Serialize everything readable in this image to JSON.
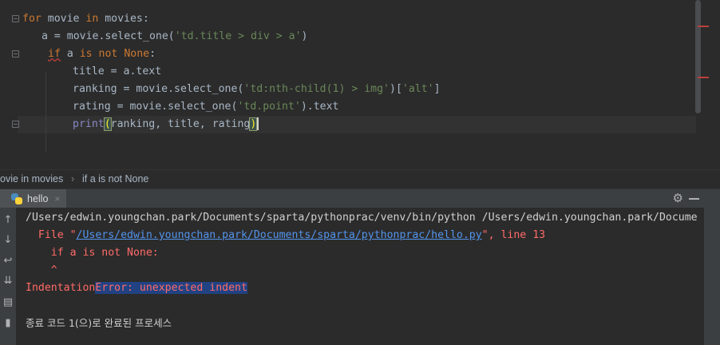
{
  "editor": {
    "code": {
      "l1": {
        "kw1": "for",
        "t1": " movie ",
        "kw2": "in",
        "t2": " movies:"
      },
      "l2": {
        "t1": "a = movie.select_one(",
        "s1": "'td.title > div > a'",
        "t2": ")"
      },
      "l3": {
        "kw1": "if",
        "t1": " a ",
        "kw2": "is not",
        "t2": " ",
        "kw3": "None",
        "t3": ":"
      },
      "l4": {
        "t1": "title = a.text"
      },
      "l5": {
        "t1": "ranking = movie.select_one(",
        "s1": "'td:nth-child(1) > img'",
        "t2": ")[",
        "s2": "'alt'",
        "t3": "]"
      },
      "l6": {
        "t1": "rating = movie.select_one(",
        "s1": "'td.point'",
        "t2": ").text"
      },
      "l7": {
        "bi": "print",
        "p1": "(",
        "t1": "ranking, title, rating",
        "p2": ")"
      }
    }
  },
  "breadcrumb": {
    "item1": "ovie in movies",
    "separator": "›",
    "item2": "if a is not None"
  },
  "run_panel": {
    "tab_label": "hello",
    "tab_close": "×",
    "settings_icon": "gear-icon",
    "minimize_icon": "minimize-icon",
    "toolbar_icons": [
      "arrow-up-icon",
      "arrow-down-icon",
      "soft-wrap-icon",
      "scroll-to-end-icon",
      "print-icon",
      "trash-icon"
    ],
    "console": {
      "line1": "/Users/edwin.youngchan.park/Documents/sparta/pythonprac/venv/bin/python /Users/edwin.youngchan.park/Docume",
      "line2": {
        "prefix": "  File \"",
        "path": "/Users/edwin.youngchan.park/Documents/sparta/pythonprac/hello.py",
        "suffix": "\", line 13"
      },
      "line3": "    if a is not None:",
      "line4": "    ^",
      "line5": {
        "pre": "Indentation",
        "sel": "Error: unexpected indent"
      },
      "line6": "종료 코드 1(으)로 완료된 프로세스"
    }
  },
  "colors": {
    "background": "#2b2b2b",
    "keyword": "#cc7832",
    "string": "#6a8759",
    "error": "#ff6b68",
    "link": "#5394ec",
    "selection": "#214283"
  }
}
